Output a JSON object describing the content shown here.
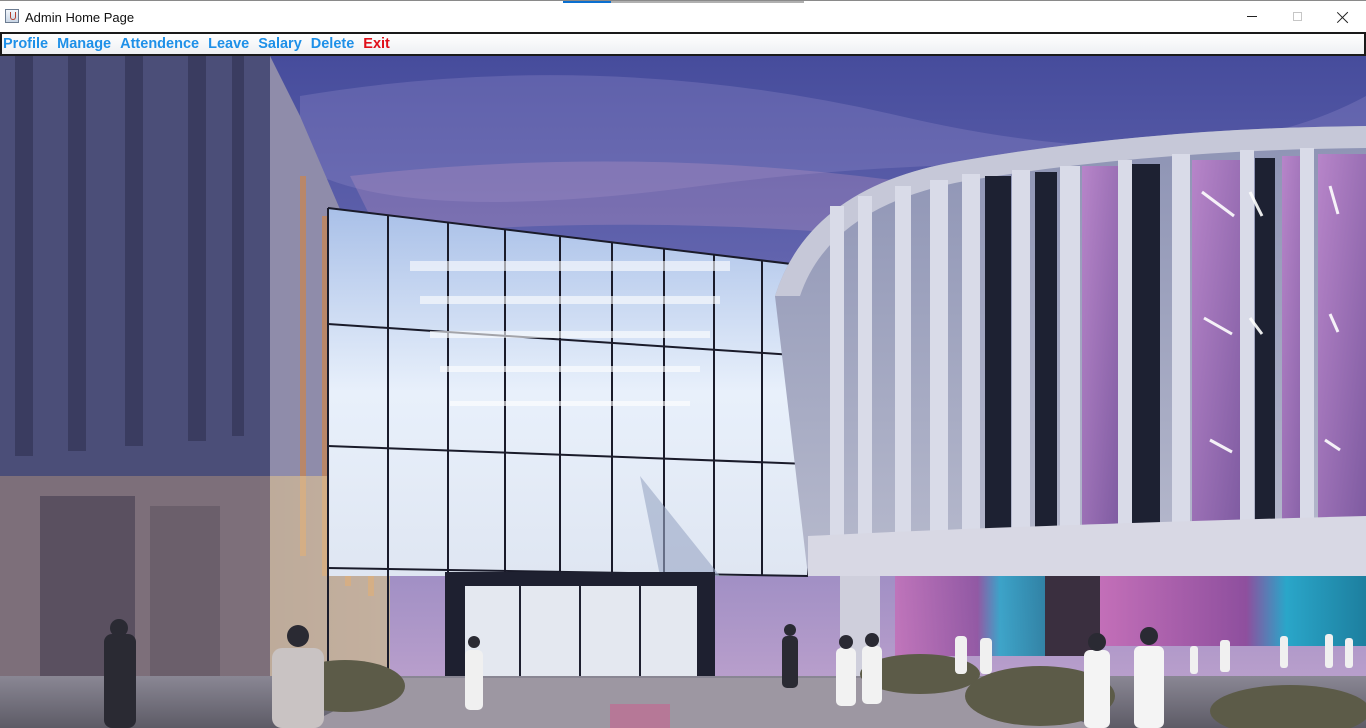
{
  "window": {
    "title": "Admin Home Page",
    "icon": "java-cup-icon",
    "controls": [
      "minimize-icon",
      "maximize-icon",
      "close-icon"
    ]
  },
  "taskbar_accent": {
    "segment1_color": "#0a6fd0",
    "segment2_color": "#b0b0b0"
  },
  "menu": {
    "items": [
      {
        "label": "Profile",
        "color": "#1e90e8"
      },
      {
        "label": "Manage",
        "color": "#1e90e8"
      },
      {
        "label": "Attendence",
        "color": "#1e90e8"
      },
      {
        "label": "Leave",
        "color": "#1e90e8"
      },
      {
        "label": "Salary",
        "color": "#1e90e8"
      },
      {
        "label": "Delete",
        "color": "#1e90e8"
      },
      {
        "label": "Exit",
        "color": "#e0101a"
      }
    ]
  },
  "background": {
    "description_icon": "building-photo-image",
    "sky_top": "#4a4f9e",
    "sky_bottom": "#b8a0c8",
    "ground": "#7a7a88"
  }
}
